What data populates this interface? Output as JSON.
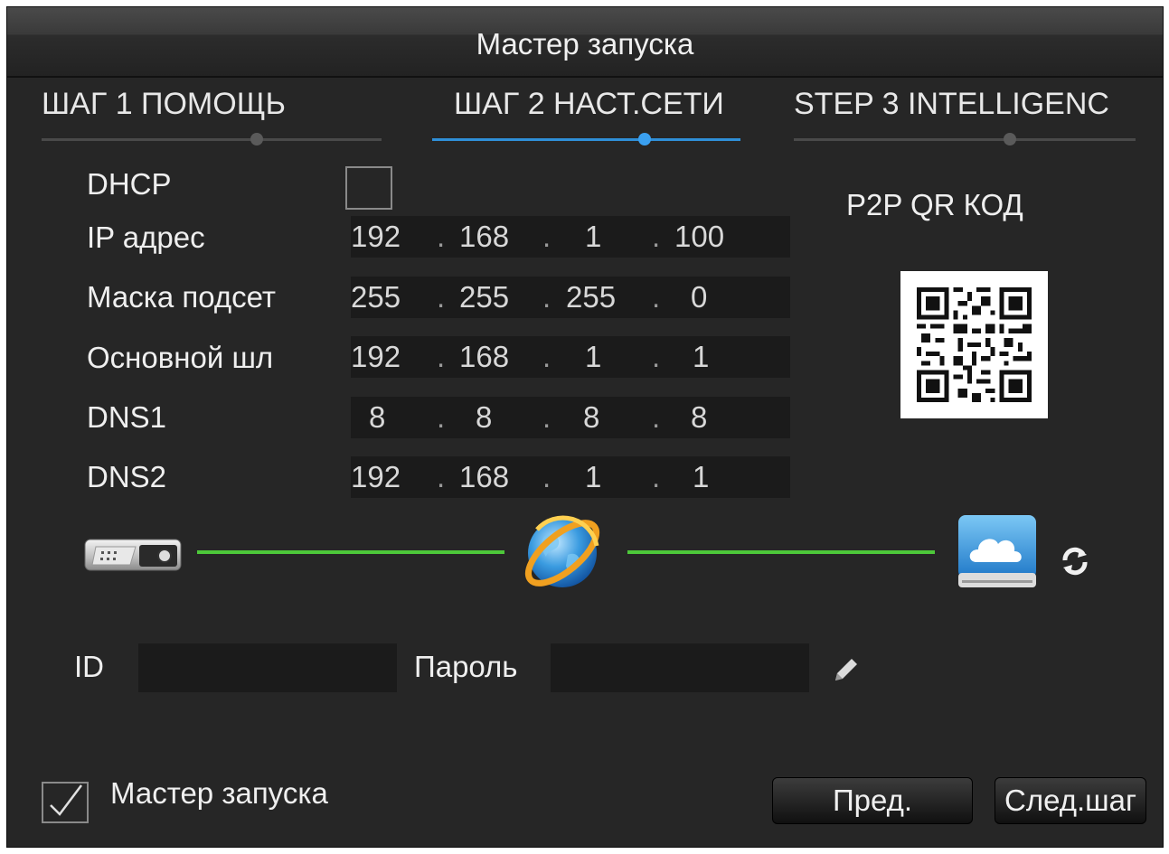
{
  "window": {
    "title": "Мастер запуска"
  },
  "steps": [
    {
      "label": "ШАГ 1 ПОМОЩЬ",
      "active": false
    },
    {
      "label": "ШАГ 2 НАСТ.СЕТИ",
      "active": true
    },
    {
      "label": "STEP 3 INTELLIGENC",
      "active": false
    }
  ],
  "network": {
    "dhcp_label": "DHCP",
    "dhcp_checked": false,
    "fields": [
      {
        "label": "IP адрес",
        "octets": [
          "192",
          "168",
          "1",
          "100"
        ]
      },
      {
        "label": "Маска подсет",
        "octets": [
          "255",
          "255",
          "255",
          "0"
        ]
      },
      {
        "label": "Основной шл",
        "octets": [
          "192",
          "168",
          "1",
          "1"
        ]
      },
      {
        "label": "DNS1",
        "octets": [
          "8",
          "8",
          "8",
          "8"
        ]
      },
      {
        "label": "DNS2",
        "octets": [
          "192",
          "168",
          "1",
          "1"
        ]
      }
    ]
  },
  "qr": {
    "title": "P2P QR КОД"
  },
  "connection": {
    "icons": [
      "dvr-device-icon",
      "internet-globe-icon",
      "cloud-icon",
      "refresh-icon"
    ],
    "link_color": "#4dc83a"
  },
  "credentials": {
    "id_label": "ID",
    "id_value": "",
    "password_label": "Пароль",
    "password_value": "",
    "edit_icon": "pencil-icon"
  },
  "footer": {
    "startup_wizard_label": "Мастер запуска",
    "startup_wizard_checked": true,
    "prev_label": "Пред.",
    "next_label": "След.шаг"
  },
  "colors": {
    "accent": "#2f8fd8",
    "background": "#262626"
  }
}
